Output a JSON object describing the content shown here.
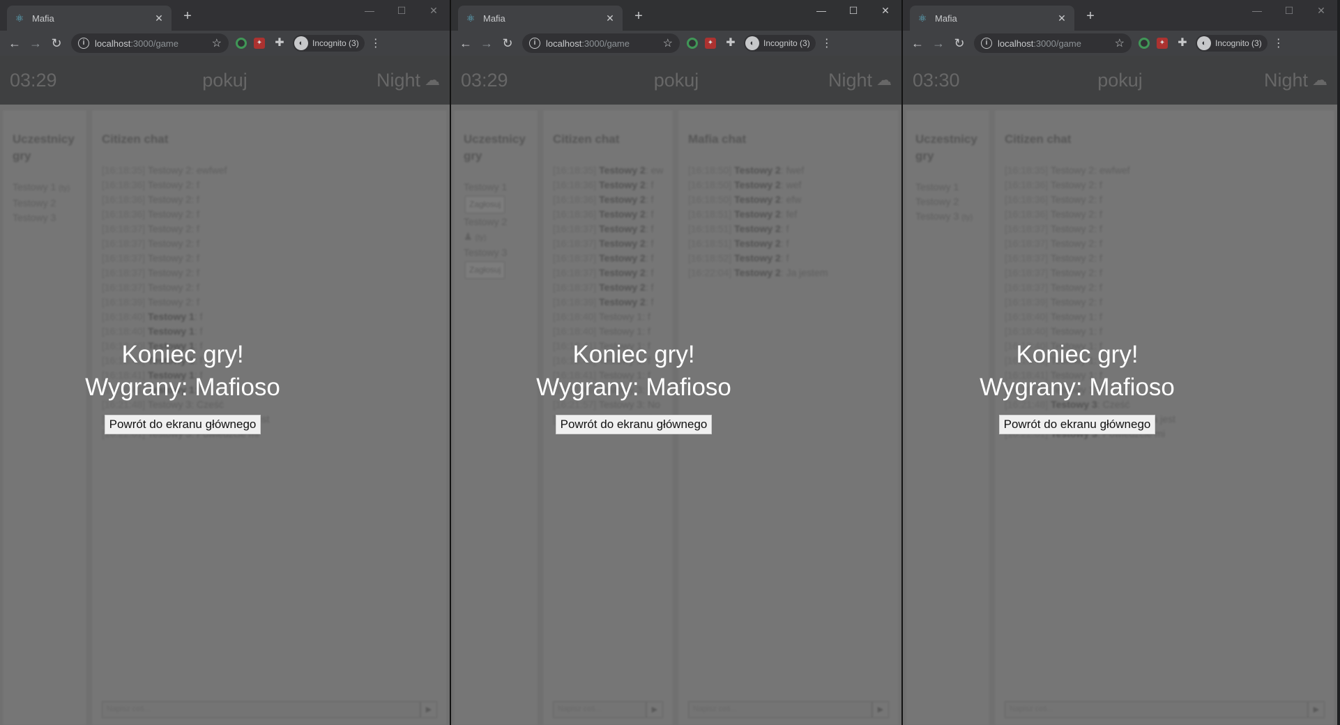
{
  "windows": [
    {
      "id": "win1",
      "active": false,
      "tab_title": "Mafia",
      "url_host": "localhost",
      "url_path": ":3000/game",
      "incognito_label": "Incognito (3)",
      "header": {
        "timer": "03:29",
        "room": "pokuj",
        "phase": "Night"
      },
      "participants": {
        "title": "Uczestnicy gry",
        "players": [
          {
            "name": "Testowy 1",
            "suffix": "(ty)"
          },
          {
            "name": "Testowy 2",
            "suffix": ""
          },
          {
            "name": "Testowy 3",
            "suffix": ""
          }
        ]
      },
      "citizen_chat": {
        "title": "Citizen chat",
        "messages": [
          {
            "time": "[16:18:35]",
            "author": "Testowy 2",
            "text": "ewfwef",
            "bold": false
          },
          {
            "time": "[16:18:36]",
            "author": "Testowy 2",
            "text": "f",
            "bold": false
          },
          {
            "time": "[16:18:36]",
            "author": "Testowy 2",
            "text": "f",
            "bold": false
          },
          {
            "time": "[16:18:36]",
            "author": "Testowy 2",
            "text": "f",
            "bold": false
          },
          {
            "time": "[16:18:37]",
            "author": "Testowy 2",
            "text": "f",
            "bold": false
          },
          {
            "time": "[16:18:37]",
            "author": "Testowy 2",
            "text": "f",
            "bold": false
          },
          {
            "time": "[16:18:37]",
            "author": "Testowy 2",
            "text": "f",
            "bold": false
          },
          {
            "time": "[16:18:37]",
            "author": "Testowy 2",
            "text": "f",
            "bold": false
          },
          {
            "time": "[16:18:37]",
            "author": "Testowy 2",
            "text": "f",
            "bold": false
          },
          {
            "time": "[16:18:39]",
            "author": "Testowy 2",
            "text": "f",
            "bold": false
          },
          {
            "time": "[16:18:40]",
            "author": "Testowy 1",
            "text": "f",
            "bold": true
          },
          {
            "time": "[16:18:40]",
            "author": "Testowy 1",
            "text": "f",
            "bold": true
          },
          {
            "time": "[16:18:40]",
            "author": "Testowy 1",
            "text": "f",
            "bold": true
          },
          {
            "time": "[16:18:41]",
            "author": "Testowy 1",
            "text": "f",
            "bold": true
          },
          {
            "time": "[16:18:41]",
            "author": "Testowy 1",
            "text": "f",
            "bold": true
          },
          {
            "time": "[16:18:41]",
            "author": "Testowy 1",
            "text": "f",
            "bold": true
          },
          {
            "time": "[16:21:48]",
            "author": "Testowy 3",
            "text": "Cześć",
            "bold": false
          },
          {
            "time": "[16:21:57]",
            "author": "Testowy 3",
            "text": "No kto mafią jest",
            "bold": false
          },
          {
            "time": "[16:22:01]",
            "author": "Testowy 3",
            "text": "Powiedzcie mi",
            "bold": false
          }
        ],
        "input_placeholder": "Napisz coś..."
      },
      "game_over": {
        "title": "Koniec gry!",
        "winner": "Wygrany: Mafioso",
        "button": "Powrót do ekranu głównego"
      }
    },
    {
      "id": "win2",
      "active": true,
      "tab_title": "Mafia",
      "url_host": "localhost",
      "url_path": ":3000/game",
      "incognito_label": "Incognito (3)",
      "header": {
        "timer": "03:29",
        "room": "pokuj",
        "phase": "Night"
      },
      "participants": {
        "title": "Uczestnicy gry",
        "players": [
          {
            "name": "Testowy 1",
            "suffix": "",
            "vote": "Zagłosuj"
          },
          {
            "name": "Testowy 2",
            "suffix": "(ty)",
            "mafia": true
          },
          {
            "name": "Testowy 3",
            "suffix": "",
            "vote": "Zagłosuj"
          }
        ]
      },
      "citizen_chat": {
        "title": "Citizen chat",
        "messages": [
          {
            "time": "[16:18:35]",
            "author": "Testowy 2",
            "text": "ewfwef",
            "bold": true
          },
          {
            "time": "[16:18:36]",
            "author": "Testowy 2",
            "text": "f",
            "bold": true
          },
          {
            "time": "[16:18:36]",
            "author": "Testowy 2",
            "text": "f",
            "bold": true
          },
          {
            "time": "[16:18:36]",
            "author": "Testowy 2",
            "text": "f",
            "bold": true
          },
          {
            "time": "[16:18:37]",
            "author": "Testowy 2",
            "text": "f",
            "bold": true
          },
          {
            "time": "[16:18:37]",
            "author": "Testowy 2",
            "text": "f",
            "bold": true
          },
          {
            "time": "[16:18:37]",
            "author": "Testowy 2",
            "text": "f",
            "bold": true
          },
          {
            "time": "[16:18:37]",
            "author": "Testowy 2",
            "text": "f",
            "bold": true
          },
          {
            "time": "[16:18:37]",
            "author": "Testowy 2",
            "text": "f",
            "bold": true
          },
          {
            "time": "[16:18:39]",
            "author": "Testowy 2",
            "text": "f",
            "bold": true
          },
          {
            "time": "[16:18:40]",
            "author": "Testowy 1",
            "text": "f",
            "bold": false
          },
          {
            "time": "[16:18:40]",
            "author": "Testowy 1",
            "text": "f",
            "bold": false
          },
          {
            "time": "[16:18:41]",
            "author": "Testowy 1",
            "text": "f",
            "bold": false
          },
          {
            "time": "[16:18:41]",
            "author": "Testowy 1",
            "text": "f",
            "bold": false
          },
          {
            "time": "[16:18:41]",
            "author": "Testowy 1",
            "text": "f",
            "bold": false
          },
          {
            "time": "[16:21:48]",
            "author": "Testowy 3",
            "text": "Cześć",
            "bold": false
          },
          {
            "time": "[16:21:57]",
            "author": "Testowy 3",
            "text": "No kto mafia jest",
            "bold": false
          },
          {
            "time": "[16:22:01]",
            "author": "Testowy 3",
            "text": "Powiedzcie mi",
            "bold": false
          }
        ],
        "input_placeholder": "Napisz coś..."
      },
      "mafia_chat": {
        "title": "Mafia chat",
        "messages": [
          {
            "time": "[16:18:50]",
            "author": "Testowy 2",
            "text": "fwef"
          },
          {
            "time": "[16:18:50]",
            "author": "Testowy 2",
            "text": "wef"
          },
          {
            "time": "[16:18:50]",
            "author": "Testowy 2",
            "text": "efw"
          },
          {
            "time": "[16:18:51]",
            "author": "Testowy 2",
            "text": "fef"
          },
          {
            "time": "[16:18:51]",
            "author": "Testowy 2",
            "text": "f"
          },
          {
            "time": "[16:18:51]",
            "author": "Testowy 2",
            "text": "f"
          },
          {
            "time": "[16:18:52]",
            "author": "Testowy 2",
            "text": "f"
          },
          {
            "time": "[16:22:04]",
            "author": "Testowy 2",
            "text": "Ja jestem"
          }
        ],
        "input_placeholder": "Napisz coś..."
      },
      "game_over": {
        "title": "Koniec gry!",
        "winner": "Wygrany: Mafioso",
        "button": "Powrót do ekranu głównego"
      }
    },
    {
      "id": "win3",
      "active": false,
      "tab_title": "Mafia",
      "url_host": "localhost",
      "url_path": ":3000/game",
      "incognito_label": "Incognito (3)",
      "header": {
        "timer": "03:30",
        "room": "pokuj",
        "phase": "Night"
      },
      "participants": {
        "title": "Uczestnicy gry",
        "players": [
          {
            "name": "Testowy 1",
            "suffix": ""
          },
          {
            "name": "Testowy 2",
            "suffix": ""
          },
          {
            "name": "Testowy 3",
            "suffix": "(ty)"
          }
        ]
      },
      "citizen_chat": {
        "title": "Citizen chat",
        "messages": [
          {
            "time": "[16:18:35]",
            "author": "Testowy 2",
            "text": "ewfwef",
            "bold": false
          },
          {
            "time": "[16:18:36]",
            "author": "Testowy 2",
            "text": "f",
            "bold": false
          },
          {
            "time": "[16:18:36]",
            "author": "Testowy 2",
            "text": "f",
            "bold": false
          },
          {
            "time": "[16:18:36]",
            "author": "Testowy 2",
            "text": "f",
            "bold": false
          },
          {
            "time": "[16:18:37]",
            "author": "Testowy 2",
            "text": "f",
            "bold": false
          },
          {
            "time": "[16:18:37]",
            "author": "Testowy 2",
            "text": "f",
            "bold": false
          },
          {
            "time": "[16:18:37]",
            "author": "Testowy 2",
            "text": "f",
            "bold": false
          },
          {
            "time": "[16:18:37]",
            "author": "Testowy 2",
            "text": "f",
            "bold": false
          },
          {
            "time": "[16:18:37]",
            "author": "Testowy 2",
            "text": "f",
            "bold": false
          },
          {
            "time": "[16:18:39]",
            "author": "Testowy 2",
            "text": "f",
            "bold": false
          },
          {
            "time": "[16:18:40]",
            "author": "Testowy 1",
            "text": "f",
            "bold": false
          },
          {
            "time": "[16:18:40]",
            "author": "Testowy 1",
            "text": "f",
            "bold": false
          },
          {
            "time": "[16:18:40]",
            "author": "Testowy 1",
            "text": "f",
            "bold": false
          },
          {
            "time": "[16:18:41]",
            "author": "Testowy 1",
            "text": "f",
            "bold": false
          },
          {
            "time": "[16:18:41]",
            "author": "Testowy 1",
            "text": "f",
            "bold": false
          },
          {
            "time": "[16:18:41]",
            "author": "Testowy 1",
            "text": "f",
            "bold": false
          },
          {
            "time": "[16:21:48]",
            "author": "Testowy 3",
            "text": "Cześć",
            "bold": true
          },
          {
            "time": "[16:21:57]",
            "author": "Testowy 3",
            "text": "No kto mafia jest",
            "bold": true
          },
          {
            "time": "[16:22:01]",
            "author": "Testowy 3",
            "text": "Powiedzcie mi",
            "bold": true
          }
        ],
        "input_placeholder": "Napisz coś..."
      },
      "game_over": {
        "title": "Koniec gry!",
        "winner": "Wygrany: Mafioso",
        "button": "Powrót do ekranu głównego"
      }
    }
  ],
  "icons": {
    "favicon": "react-atom-icon",
    "close": "close-icon",
    "new_tab": "plus-icon",
    "back": "arrow-left-icon",
    "forward": "arrow-right-icon",
    "reload": "reload-icon",
    "site_info": "info-icon",
    "bookmark": "star-icon",
    "phase": "moon-cloud-icon",
    "mafia_role": "hat-icon",
    "send": "send-icon"
  },
  "colors": {
    "chrome_dark": "#202124",
    "toolbar": "#35363a",
    "app_header": "#333436",
    "page_overlay": "#747474",
    "overlay_text": "#ffffff"
  }
}
